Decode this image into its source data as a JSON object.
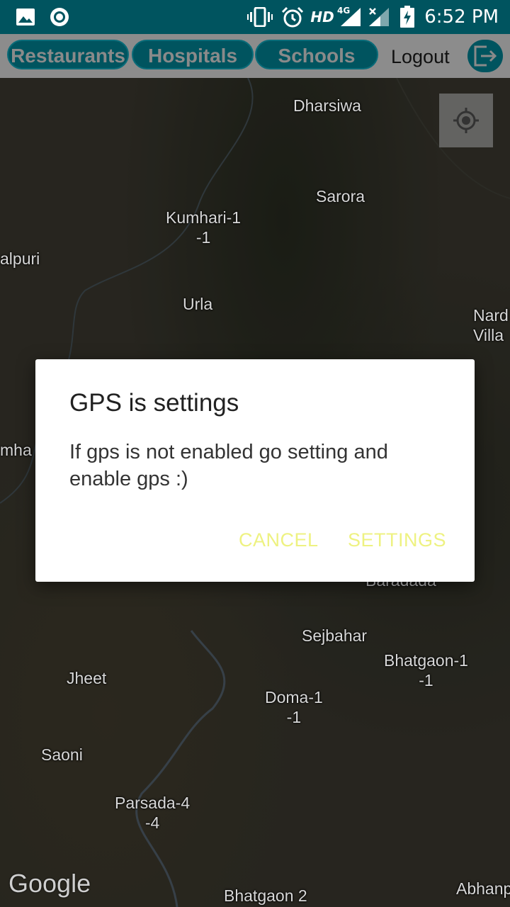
{
  "status_bar": {
    "time": "6:52 PM",
    "network_label": "HD",
    "network_type": "4G",
    "icons": [
      "gallery-icon",
      "circle-app-icon",
      "vibrate-icon",
      "alarm-icon",
      "signal-icon",
      "no-signal-icon",
      "battery-charging-icon"
    ]
  },
  "toolbar": {
    "categories": [
      "Restaurants",
      "Hospitals",
      "Schools"
    ],
    "logout_label": "Logout"
  },
  "map": {
    "places": [
      "Dharsiwa",
      "Sarora",
      "Kumhari-1\n-1",
      "alpuri",
      "Urla",
      "Nard\nVilla",
      "mha",
      "Sejbahar",
      "Bhatgaon-1\n-1",
      "Jheet",
      "Doma-1\n-1",
      "Saoni",
      "Parsada-4\n-4",
      "Bhatgaon 2",
      "Abhanp",
      "Baradada"
    ],
    "attribution": "Google"
  },
  "dialog": {
    "title": "GPS is settings",
    "message": "If gps is not enabled go setting and enable gps :)",
    "cancel_label": "CANCEL",
    "settings_label": "SETTINGS"
  },
  "colors": {
    "primary": "#00545f",
    "accent": "#eef281",
    "toolbar_bg": "#8c8c8c"
  }
}
